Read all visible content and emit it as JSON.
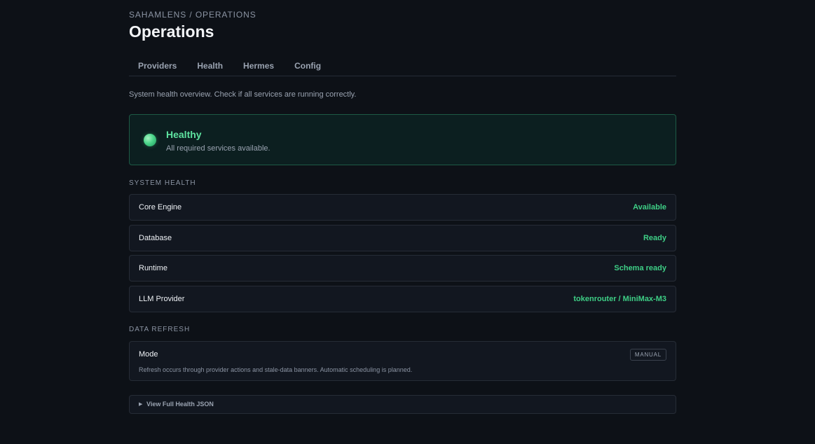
{
  "breadcrumb": "SAHAMLENS / OPERATIONS",
  "title": "Operations",
  "tabs": [
    {
      "label": "Providers"
    },
    {
      "label": "Health"
    },
    {
      "label": "Hermes"
    },
    {
      "label": "Config"
    }
  ],
  "intro": "System health overview. Check if all services are running correctly.",
  "status": {
    "title": "Healthy",
    "subtitle": "All required services available.",
    "color": "#5ee3a0"
  },
  "system_health": {
    "label": "SYSTEM HEALTH",
    "rows": [
      {
        "label": "Core Engine",
        "value": "Available"
      },
      {
        "label": "Database",
        "value": "Ready"
      },
      {
        "label": "Runtime",
        "value": "Schema ready"
      },
      {
        "label": "LLM Provider",
        "value": "tokenrouter / MiniMax-M3"
      }
    ]
  },
  "data_refresh": {
    "label": "DATA REFRESH",
    "mode_title": "Mode",
    "mode_badge": "MANUAL",
    "mode_desc": "Refresh occurs through provider actions and stale-data banners. Automatic scheduling is planned."
  },
  "json_toggle": {
    "icon": "caret-right-icon",
    "label": "View Full Health JSON"
  }
}
